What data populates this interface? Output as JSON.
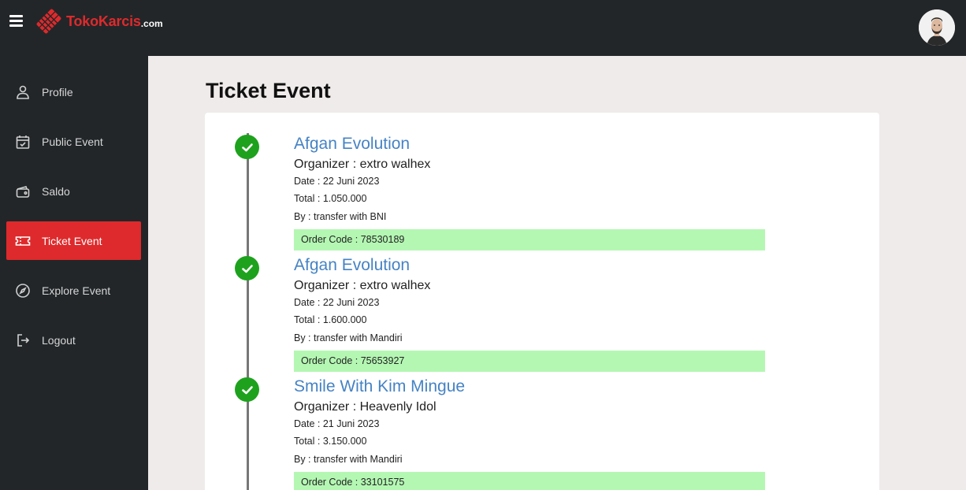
{
  "brand": {
    "name": "TokoKarcis",
    "tld": ".com",
    "accent": "#de2a2c"
  },
  "sidebar": {
    "items": [
      {
        "label": "Profile",
        "icon": "user-icon",
        "active": false
      },
      {
        "label": "Public Event",
        "icon": "calendar-check-icon",
        "active": false
      },
      {
        "label": "Saldo",
        "icon": "wallet-icon",
        "active": false
      },
      {
        "label": "Ticket Event",
        "icon": "ticket-icon",
        "active": true
      },
      {
        "label": "Explore Event",
        "icon": "compass-icon",
        "active": false
      },
      {
        "label": "Logout",
        "icon": "logout-icon",
        "active": false
      }
    ]
  },
  "main": {
    "title": "Ticket Event",
    "tickets": [
      {
        "event": "Afgan Evolution",
        "organizer": "Organizer : extro walhex",
        "date": "Date : 22 Juni 2023",
        "total": "Total : 1.050.000",
        "by": "By : transfer with BNI",
        "order_code": "Order Code : 78530189"
      },
      {
        "event": "Afgan Evolution",
        "organizer": "Organizer : extro walhex",
        "date": "Date : 22 Juni 2023",
        "total": "Total : 1.600.000",
        "by": "By : transfer with Mandiri",
        "order_code": "Order Code : 75653927"
      },
      {
        "event": "Smile With Kim Mingue",
        "organizer": "Organizer : Heavenly Idol",
        "date": "Date : 21 Juni 2023",
        "total": "Total : 3.150.000",
        "by": "By : transfer with Mandiri",
        "order_code": "Order Code : 33101575"
      }
    ]
  },
  "colors": {
    "topbar": "#222629",
    "active": "#de2a2c",
    "check": "#1ea21e",
    "order_bg": "#b4f7b3",
    "event_title": "#4583c4"
  }
}
